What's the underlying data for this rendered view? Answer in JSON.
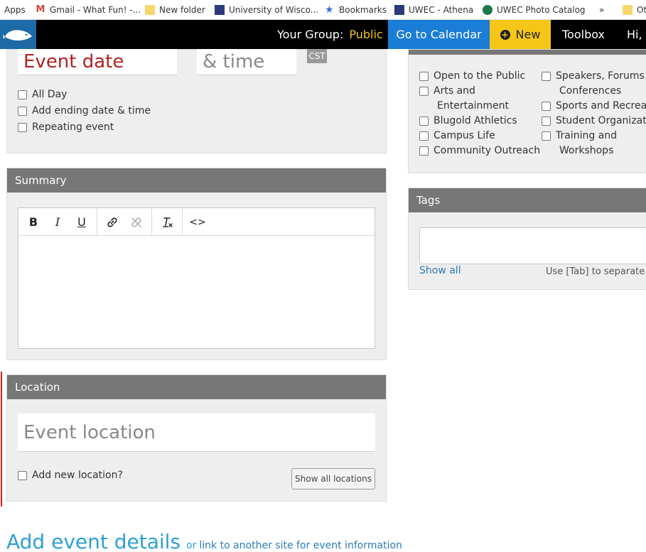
{
  "bookmarks": [
    {
      "label": "Apps",
      "icon": "apps-grid-icon"
    },
    {
      "label": "Gmail - What Fun! -...",
      "icon": "gmail-icon"
    },
    {
      "label": "New folder",
      "icon": "folder-icon"
    },
    {
      "label": "University of Wisco...",
      "icon": "uw-icon"
    },
    {
      "label": "Bookmarks",
      "icon": "star-icon"
    },
    {
      "label": "UWEC - Athena",
      "icon": "uw-icon"
    },
    {
      "label": "UWEC Photo Catalog",
      "icon": "photo-icon"
    },
    {
      "label": "»",
      "icon": "chevrons-right-icon"
    },
    {
      "label": "Ot",
      "icon": "folder-icon"
    }
  ],
  "header": {
    "group_label": "Your Group:",
    "group_value": "Public",
    "calendar_label": "Go to Calendar",
    "new_label": "New",
    "toolbox_label": "Toolbox",
    "greeting": "Hi, I"
  },
  "datetime": {
    "date_placeholder": "Event date",
    "time_placeholder": "& time",
    "timezone": "CST",
    "all_day": "All Day",
    "ending": "Add ending date & time",
    "repeating": "Repeating event"
  },
  "summary": {
    "title": "Summary",
    "toolbar": {
      "bold": "B",
      "italic": "I",
      "underline": "U",
      "source": "<>"
    }
  },
  "location": {
    "title": "Location",
    "placeholder": "Event location",
    "add_new": "Add new location?",
    "show_all": "Show all locations"
  },
  "categories": {
    "col1": [
      "Open to the Public",
      "Arts and",
      "Entertainment",
      "Blugold Athletics",
      "Campus Life",
      "Community Outreach"
    ],
    "col2": [
      "Speakers, Forums an",
      "Conferences",
      "Sports and Recreatio",
      "Student Organizatio",
      "Training and",
      "Workshops"
    ]
  },
  "tags": {
    "title": "Tags",
    "show_all": "Show all",
    "hint": "Use [Tab] to separate t"
  },
  "details": {
    "title": "Add event details",
    "or": "or",
    "link": "link to another site for event information"
  },
  "colors": {
    "header_bg": "#000000",
    "calendar_blue": "#1a7dd6",
    "new_yellow": "#f5c518",
    "panel_head": "#777777",
    "link_blue": "#2e9fd6"
  }
}
